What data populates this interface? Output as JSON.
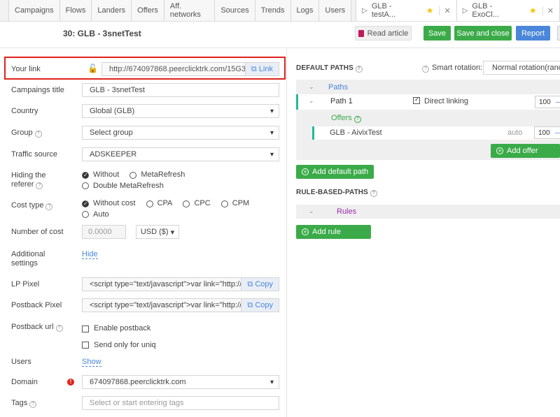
{
  "nav": {
    "tabs": [
      "Campaigns",
      "Flows",
      "Landers",
      "Offers",
      "Aff. networks",
      "Sources",
      "Trends",
      "Logs",
      "Users"
    ],
    "open_tabs": [
      {
        "label": "GLB - testA..."
      },
      {
        "label": "GLB - ExoCl..."
      }
    ]
  },
  "header": {
    "title": "30: GLB - 3snetTest",
    "read_article": "Read article",
    "save": "Save",
    "save_close": "Save and close",
    "report": "Report"
  },
  "form": {
    "your_link": {
      "label": "Your link",
      "value": "http://674097868.peerclicktrk.com/15G3",
      "button": "Link"
    },
    "campaign_title": {
      "label": "Campaings title",
      "value": "GLB - 3snetTest"
    },
    "country": {
      "label": "Country",
      "value": "Global (GLB)"
    },
    "group": {
      "label": "Group",
      "value": "Select group"
    },
    "traffic_source": {
      "label": "Traffic source",
      "value": "ADSKEEPER"
    },
    "hiding_referer": {
      "label_line1": "Hiding the",
      "label_line2": "referer",
      "options": [
        "Without",
        "MetaRefresh",
        "Double MetaRefresh"
      ],
      "selected": "Without"
    },
    "cost_type": {
      "label": "Cost type",
      "options": [
        "Without cost",
        "CPA",
        "CPC",
        "CPM",
        "Auto"
      ],
      "selected": "Without cost"
    },
    "number_of_cost": {
      "label": "Number of cost",
      "placeholder": "0.0000",
      "currency": "USD ($)"
    },
    "additional_settings": {
      "label_line1": "Additional",
      "label_line2": "settings",
      "toggle": "Hide"
    },
    "lp_pixel": {
      "label": "LP Pixel",
      "value": "<script type=\"text/javascript\">var link=\"http://",
      "button": "Copy"
    },
    "postback_pixel": {
      "label": "Postback Pixel",
      "value": "<script type=\"text/javascript\">var link=\"http://",
      "button": "Copy"
    },
    "postback_url": {
      "label": "Postback url",
      "enable": "Enable postback",
      "uniq": "Send only for uniq"
    },
    "users": {
      "label": "Users",
      "toggle": "Show"
    },
    "domain": {
      "label": "Domain",
      "value": "674097868.peerclicktrk.com"
    },
    "tags": {
      "label": "Tags",
      "placeholder": "Select or start entering tags"
    }
  },
  "paths": {
    "default_title": "DEFAULT PATHS",
    "smart_rotation": "Smart rotation:",
    "rotation_value": "Normal rotation(rand",
    "paths_label": "Paths",
    "path_name": "Path 1",
    "direct_linking": "Direct linking",
    "path_weight": "100",
    "offers_label": "Offers",
    "offer_name": "GLB - AivixTest",
    "offer_auto": "auto",
    "offer_weight": "100",
    "add_offer": "Add offer",
    "add_default_path": "Add default path",
    "rule_title": "RULE-BASED-PATHS",
    "rules_label": "Rules",
    "add_rule": "Add rule"
  },
  "colors": {
    "green": "#3aab48",
    "blue": "#4a86d9",
    "highlight_red": "#e0221a",
    "teal": "#26b89a"
  }
}
